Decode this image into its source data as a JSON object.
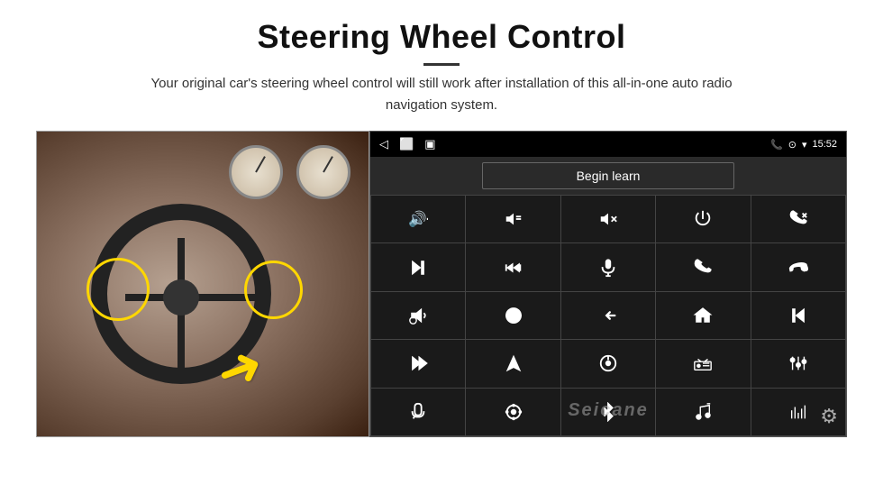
{
  "header": {
    "title": "Steering Wheel Control",
    "subtitle": "Your original car's steering wheel control will still work after installation of this all-in-one auto radio navigation system."
  },
  "statusbar": {
    "back_icon": "◁",
    "home_icon": "⬜",
    "recents_icon": "▣",
    "phone_icon": "📞",
    "location_icon": "⊙",
    "signal_icon": "▾",
    "time": "15:52"
  },
  "begin_learn_button": "Begin learn",
  "control_buttons": [
    {
      "icon": "vol_up",
      "label": "Volume Up",
      "unicode": ""
    },
    {
      "icon": "vol_down",
      "label": "Volume Down",
      "unicode": ""
    },
    {
      "icon": "mute",
      "label": "Mute",
      "unicode": ""
    },
    {
      "icon": "power",
      "label": "Power",
      "unicode": ""
    },
    {
      "icon": "phone_end",
      "label": "Phone End",
      "unicode": ""
    },
    {
      "icon": "skip_next",
      "label": "Skip Next",
      "unicode": ""
    },
    {
      "icon": "ff",
      "label": "Fast Forward",
      "unicode": ""
    },
    {
      "icon": "mic",
      "label": "Microphone",
      "unicode": ""
    },
    {
      "icon": "call",
      "label": "Call",
      "unicode": ""
    },
    {
      "icon": "hang_up",
      "label": "Hang Up",
      "unicode": ""
    },
    {
      "icon": "horn",
      "label": "Horn/Alert",
      "unicode": ""
    },
    {
      "icon": "360",
      "label": "360 View",
      "unicode": ""
    },
    {
      "icon": "back",
      "label": "Back",
      "unicode": ""
    },
    {
      "icon": "home",
      "label": "Home",
      "unicode": ""
    },
    {
      "icon": "rew",
      "label": "Rewind",
      "unicode": ""
    },
    {
      "icon": "skip_fwd",
      "label": "Skip Forward",
      "unicode": ""
    },
    {
      "icon": "nav",
      "label": "Navigation",
      "unicode": ""
    },
    {
      "icon": "eject",
      "label": "Eject/Source",
      "unicode": ""
    },
    {
      "icon": "radio",
      "label": "Radio",
      "unicode": ""
    },
    {
      "icon": "eq",
      "label": "Equalizer",
      "unicode": ""
    },
    {
      "icon": "mic2",
      "label": "Mic2",
      "unicode": ""
    },
    {
      "icon": "settings2",
      "label": "Settings2",
      "unicode": ""
    },
    {
      "icon": "bt",
      "label": "Bluetooth",
      "unicode": ""
    },
    {
      "icon": "music",
      "label": "Music",
      "unicode": ""
    },
    {
      "icon": "levels",
      "label": "Audio Levels",
      "unicode": ""
    }
  ],
  "watermark": "Seicane",
  "gear_icon": "⚙"
}
